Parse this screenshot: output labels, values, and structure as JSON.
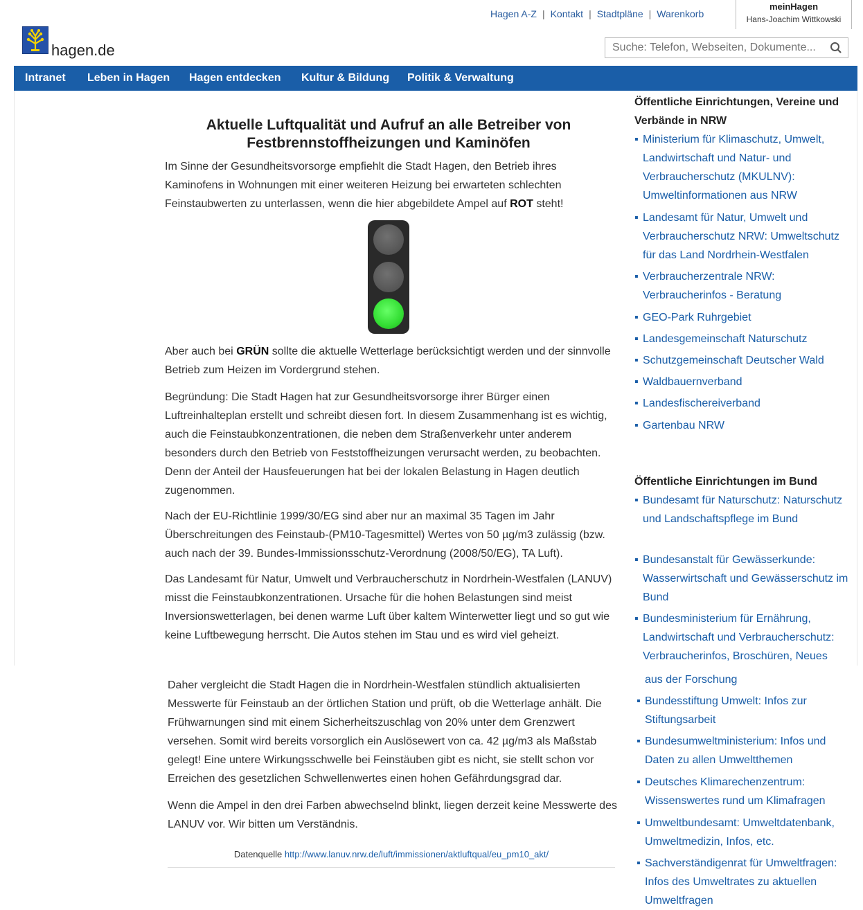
{
  "header": {
    "top_links": [
      "Hagen A-Z",
      "Kontakt",
      "Stadtpläne",
      "Warenkorb"
    ],
    "mein_title": "meinHagen",
    "mein_user": "Hans-Joachim Wittkowski",
    "brand": "hagen.de",
    "search_placeholder": "Suche: Telefon, Webseiten, Dokumente..."
  },
  "nav": [
    "Intranet",
    "Leben in Hagen",
    "Hagen entdecken",
    "Kultur & Bildung",
    "Politik & Verwaltung"
  ],
  "article": {
    "title": "Aktuelle Luftqualität und Aufruf an alle Betreiber von Festbrennstoffheizungen und Kaminöfen",
    "intro_pre": "Im Sinne der Gesundheitsvorsorge empfiehlt die Stadt Hagen, den Betrieb ihres Kaminofens in Wohnungen mit einer weiteren Heizung bei erwarteten schlechten Feinstaubwerten zu unterlassen, wenn die hier abgebildete Ampel auf ",
    "intro_bold": "ROT",
    "intro_post": " steht!",
    "traffic_light_active": "green",
    "green_pre": "Aber auch bei ",
    "green_bold": "GRÜN",
    "green_post": " sollte die aktuelle Wetterlage berücksichtigt werden und der sinnvolle Betrieb zum Heizen im Vordergrund stehen.",
    "p_begruendung": "Begründung: Die Stadt Hagen hat zur Gesundheitsvorsorge ihrer Bürger einen Luftreinhalteplan erstellt und schreibt diesen fort. In diesem Zusammenhang ist es wichtig, auch die Feinstaubkonzentrationen, die neben dem Straßenverkehr unter anderem besonders durch den Betrieb von Feststoffheizungen verursacht werden, zu beobachten. Denn der Anteil der Hausfeuerungen hat bei der lokalen Belastung in Hagen deutlich zugenommen.",
    "p_eu": "Nach der EU-Richtlinie 1999/30/EG sind aber nur an maximal 35 Tagen im Jahr Überschreitungen des Feinstaub-(PM10-Tagesmittel) Wertes von 50 µg/m3 zulässig (bzw. auch nach der 39. Bundes-Immissionsschutz-Verordnung (2008/50/EG), TA Luft).",
    "p_lanuv": "Das Landesamt für Natur, Umwelt und Verbraucherschutz in Nordrhein-Westfalen (LANUV) misst die Feinstaubkonzentrationen. Ursache für die hohen Belastungen sind meist Inversionswetterlagen, bei denen warme Luft über kaltem Winterwetter liegt und so gut wie keine Luftbewegung herrscht. Die Autos stehen im Stau und es wird viel geheizt.",
    "p_daher": "Daher vergleicht die Stadt Hagen die in Nordrhein-Westfalen stündlich aktualisierten Messwerte für Feinstaub an der örtlichen Station und prüft, ob die Wetterlage anhält. Die Frühwarnungen sind mit einem Sicherheitszuschlag von 20% unter dem Grenzwert versehen. Somit wird bereits vorsorglich ein Auslösewert von ca. 42 µg/m3 als Maßstab gelegt! Eine untere Wirkungsschwelle bei Feinstäuben gibt es nicht, sie stellt schon vor Erreichen des gesetzlichen Schwellenwertes einen hohen Gefährdungsgrad dar.",
    "p_ampel": "Wenn die Ampel in den drei Farben abwechselnd blinkt, liegen derzeit keine Messwerte des LANUV vor. Wir bitten um Verständnis.",
    "source_label": "Datenquelle ",
    "source_link": "http://www.lanuv.nrw.de/luft/immissionen/aktluftqual/eu_pm10_akt/"
  },
  "sidebar": {
    "nrw_heading": "Öffentliche Einrichtungen, Vereine und Verbände in NRW",
    "nrw_items": [
      "Ministerium für Klimaschutz, Umwelt, Landwirtschaft und Natur- und Verbraucherschutz (MKULNV): Umweltinformationen aus NRW",
      "Landesamt für Natur, Umwelt und Verbraucherschutz NRW: Umweltschutz für das Land Nordrhein-Westfalen",
      "Verbraucherzentrale NRW: Verbraucherinfos - Beratung",
      "GEO-Park Ruhrgebiet",
      "Landesgemeinschaft Naturschutz",
      "Schutzgemeinschaft Deutscher Wald",
      "Waldbauernverband",
      "Landesfischereiverband",
      "Gartenbau NRW"
    ],
    "bund_heading": "Öffentliche Einrichtungen im Bund",
    "bund_items": [
      "Bundesamt für Naturschutz: Naturschutz und Landschaftspflege im Bund",
      "Bundesanstalt für Gewässerkunde: Wasserwirtschaft und Gewässerschutz im Bund",
      "Bundesministerium für Ernährung, Landwirtschaft und Verbraucherschutz: Verbraucherinfos, Broschüren, Neues",
      "aus der Forschung",
      "Bundesstiftung Umwelt: Infos zur Stiftungsarbeit",
      "Bundesumweltministerium: Infos und Daten zu allen Umweltthemen",
      "Deutsches Klimarechenzentrum: Wissenswertes rund um Klimafragen",
      "Umweltbundesamt: Umweltdatenbank, Umweltmedizin, Infos, etc.",
      "Sachverständigenrat für Umweltfragen: Infos des Umweltrates zu aktuellen Umweltfragen"
    ]
  },
  "colors": {
    "brand_blue": "#1a5ea8",
    "light_green": "#33dd33"
  }
}
